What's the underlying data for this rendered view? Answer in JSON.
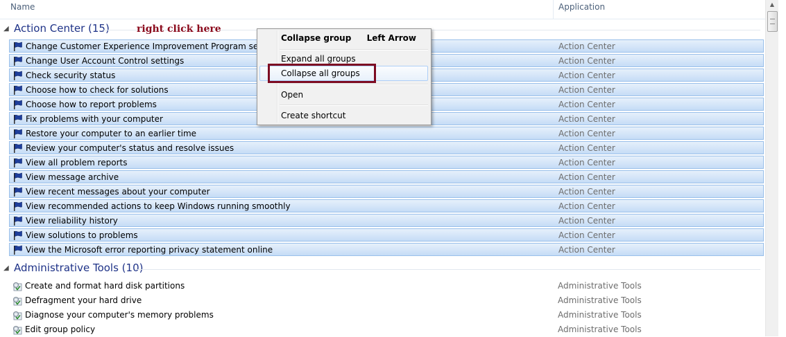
{
  "header": {
    "col_name": "Name",
    "col_application": "Application"
  },
  "hint_text": "right click here",
  "groups": [
    {
      "title": "Action Center (15)",
      "icon": "flag-icon",
      "items": [
        {
          "name": "Change Customer Experience Improvement Program settings",
          "app": "Action Center"
        },
        {
          "name": "Change User Account Control settings",
          "app": "Action Center"
        },
        {
          "name": "Check security status",
          "app": "Action Center"
        },
        {
          "name": "Choose how to check for solutions",
          "app": "Action Center"
        },
        {
          "name": "Choose how to report problems",
          "app": "Action Center"
        },
        {
          "name": "Fix problems with your computer",
          "app": "Action Center"
        },
        {
          "name": "Restore your computer to an earlier time",
          "app": "Action Center"
        },
        {
          "name": "Review your computer's status and resolve issues",
          "app": "Action Center"
        },
        {
          "name": "View all problem reports",
          "app": "Action Center"
        },
        {
          "name": "View message archive",
          "app": "Action Center"
        },
        {
          "name": "View recent messages about your computer",
          "app": "Action Center"
        },
        {
          "name": "View recommended actions to keep Windows running smoothly",
          "app": "Action Center"
        },
        {
          "name": "View reliability history",
          "app": "Action Center"
        },
        {
          "name": "View solutions to problems",
          "app": "Action Center"
        },
        {
          "name": "View the Microsoft error reporting privacy statement online",
          "app": "Action Center"
        }
      ]
    },
    {
      "title": "Administrative Tools (10)",
      "icon": "admin-tools-icon",
      "items": [
        {
          "name": "Create and format hard disk partitions",
          "app": "Administrative Tools"
        },
        {
          "name": "Defragment your hard drive",
          "app": "Administrative Tools"
        },
        {
          "name": "Diagnose your computer's memory problems",
          "app": "Administrative Tools"
        },
        {
          "name": "Edit group policy",
          "app": "Administrative Tools"
        }
      ]
    }
  ],
  "context_menu": {
    "collapse_group": "Collapse group",
    "collapse_group_key": "Left Arrow",
    "expand_all": "Expand all groups",
    "collapse_all": "Collapse all groups",
    "open": "Open",
    "create_shortcut": "Create shortcut"
  },
  "colors": {
    "group_title": "#1e3287",
    "selection": "#c5dcf6",
    "annotation": "#7d0b22"
  }
}
